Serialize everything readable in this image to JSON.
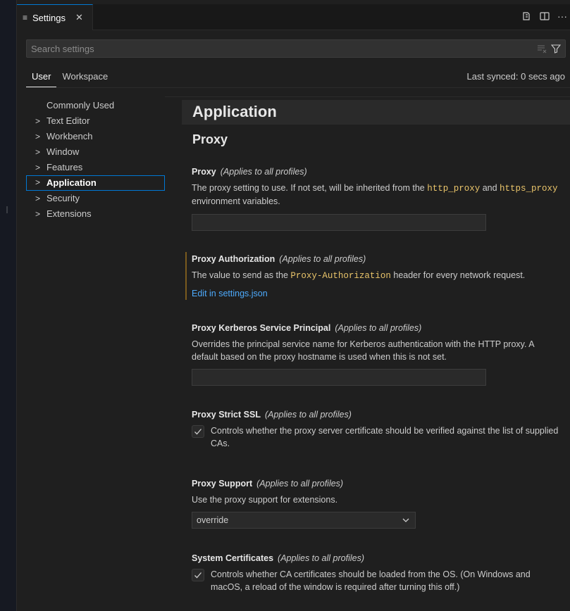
{
  "tab": {
    "title": "Settings",
    "close": "✕",
    "more": "···"
  },
  "search": {
    "placeholder": "Search settings"
  },
  "scope_tabs": [
    "User",
    "Workspace"
  ],
  "last_synced": "Last synced: 0 secs ago",
  "toc": [
    {
      "label": "Commonly Used",
      "expandable": false
    },
    {
      "label": "Text Editor",
      "expandable": true
    },
    {
      "label": "Workbench",
      "expandable": true
    },
    {
      "label": "Window",
      "expandable": true
    },
    {
      "label": "Features",
      "expandable": true
    },
    {
      "label": "Application",
      "expandable": true,
      "selected": true
    },
    {
      "label": "Security",
      "expandable": true
    },
    {
      "label": "Extensions",
      "expandable": true
    }
  ],
  "section": {
    "title": "Application",
    "subtitle": "Proxy"
  },
  "scope_note": "(Applies to all profiles)",
  "settings": {
    "proxy": {
      "title": "Proxy",
      "desc_a": "The proxy setting to use. If not set, will be inherited from the ",
      "code_a": "http_proxy",
      "desc_b": " and ",
      "code_b": "https_proxy",
      "desc_c": " environment variables.",
      "value": ""
    },
    "proxy_auth": {
      "title": "Proxy Authorization",
      "desc_a": "The value to send as the ",
      "code_a": "Proxy-Authorization",
      "desc_b": " header for every network request.",
      "link": "Edit in settings.json"
    },
    "kerberos": {
      "title": "Proxy Kerberos Service Principal",
      "desc": "Overrides the principal service name for Kerberos authentication with the HTTP proxy. A default based on the proxy hostname is used when this is not set.",
      "value": ""
    },
    "strict_ssl": {
      "title": "Proxy Strict SSL",
      "label": "Controls whether the proxy server certificate should be verified against the list of supplied CAs.",
      "checked": true
    },
    "proxy_support": {
      "title": "Proxy Support",
      "desc": "Use the proxy support for extensions.",
      "selected": "override"
    },
    "system_certs": {
      "title": "System Certificates",
      "label": "Controls whether CA certificates should be loaded from the OS. (On Windows and macOS, a reload of the window is required after turning this off.)",
      "checked": true
    }
  },
  "colors": {
    "accent": "#0078d4",
    "link": "#4daafc",
    "code": "#e9c46a",
    "background": "#1f1f1f"
  }
}
